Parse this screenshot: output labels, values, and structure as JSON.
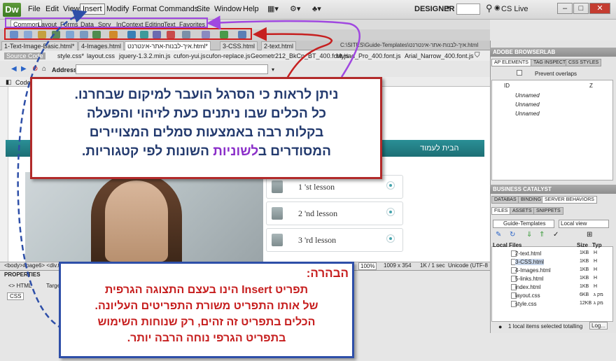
{
  "app": {
    "logo": "Dw",
    "workspace": "DESIGNER",
    "cslive": "CS Live"
  },
  "menu": [
    "File",
    "Edit",
    "View",
    "Insert",
    "Modify",
    "Format",
    "Commands",
    "Site",
    "Window",
    "Help"
  ],
  "insert_tabs": [
    "Common",
    "Layout",
    "Forms",
    "Data",
    "Spry",
    "InContext Editing",
    "Text",
    "Favorites"
  ],
  "doc_tabs": [
    "1-Text-Image-Basic.html*",
    "4-Images.html",
    "איך-לבנות-אתר-אינטרנט.html*",
    "3-CSS.html",
    "2-text.html"
  ],
  "path_label": "C:\\SITES\\Guide-Templates\\איך-לבנות-אתר-אינטרנט.html",
  "related_files": [
    "Source Code",
    "style.css*",
    "layout.css",
    "jquery-1.3.2.min.js",
    "cufon-yui.js",
    "cufon-replace.js",
    "Geometr212_BkCn_BT_400.font.js",
    "Myriad_Pro_400.font.js",
    "Arial_Narrow_400.font.js"
  ],
  "address": {
    "label": "Address:",
    "value": ""
  },
  "code_label": "Code",
  "site": {
    "home": "הבית לעמוד",
    "lessons": [
      "1 'st lesson",
      "2 'nd lesson",
      "3 'rd lesson"
    ]
  },
  "status": {
    "tag_path": "<body>#page6> <div.t",
    "zoom": "100%",
    "size": "1009 x 354",
    "download": "1K / 1 sec",
    "encoding": "Unicode (UTF-8"
  },
  "properties": {
    "title": "PROPERTIES",
    "html": "<> HTML",
    "css": "CSS",
    "target": "Targe"
  },
  "right": {
    "browserlab": "ADOBE BROWSERLAB",
    "ap_tabs": [
      "AP ELEMENTS",
      "TAG INSPECT",
      "CSS STYLES"
    ],
    "prevent_overlaps": "Prevent overlaps",
    "ap_headers": [
      "ID",
      "Z"
    ],
    "ap_rows": [
      "Unnamed",
      "Unnamed",
      "Unnamed"
    ],
    "business": "BUSINESS CATALYST",
    "db_tabs": [
      "DATABAS",
      "BINDING",
      "SERVER BEHAVIORS"
    ],
    "files_tabs": [
      "FILES",
      "ASSETS",
      "SNIPPETS"
    ],
    "site_select": "Guide-Templates",
    "view_select": "Local view",
    "files_headers": [
      "Local Files",
      "Size",
      "Typ"
    ],
    "files": [
      {
        "name": "2-text.html",
        "size": "1KB",
        "type": "H"
      },
      {
        "name": "3-CSS.html",
        "size": "1KB",
        "type": "H"
      },
      {
        "name": "4-Images.html",
        "size": "1KB",
        "type": "H"
      },
      {
        "name": "5-links.html",
        "size": "1KB",
        "type": "H"
      },
      {
        "name": "index.html",
        "size": "1KB",
        "type": "H"
      },
      {
        "name": "layout.css",
        "size": "6KB",
        "type": "מק ג"
      },
      {
        "name": "style.css",
        "size": "12KB",
        "type": "מק ג"
      }
    ],
    "files_status": "1 local items selected totalling",
    "log_btn": "Log..."
  },
  "callouts": {
    "red_lines": [
      "ניתן לראות כי הסרגל הועבר למיקום שבחרנו.",
      "כל הכלים שבו ניתנים כעת לזיהוי והפעלה",
      "בקלות רבה באמצעות סמלים המצויירים"
    ],
    "red_last_a": "המסודרים ב",
    "red_last_purple": "לשוניות",
    "red_last_b": " השונות לפי קטגוריות.",
    "blue_title": "הבהרה:",
    "blue_lines": [
      "תפריט Insert הינו בעצם התצוגה הגרפית",
      "של אותו התפריט משורת התפריטים העליונה.",
      "הכלים בתפריט זה זהים, רק שנוחות השימוש",
      "בתפריט הגרפי נוחה הרבה יותר."
    ]
  },
  "colors": {
    "red_accent": "#b22a2a",
    "blue_accent": "#2e4fa8",
    "purple_accent": "#a048e0",
    "teal_nav": "#1d6f75"
  }
}
